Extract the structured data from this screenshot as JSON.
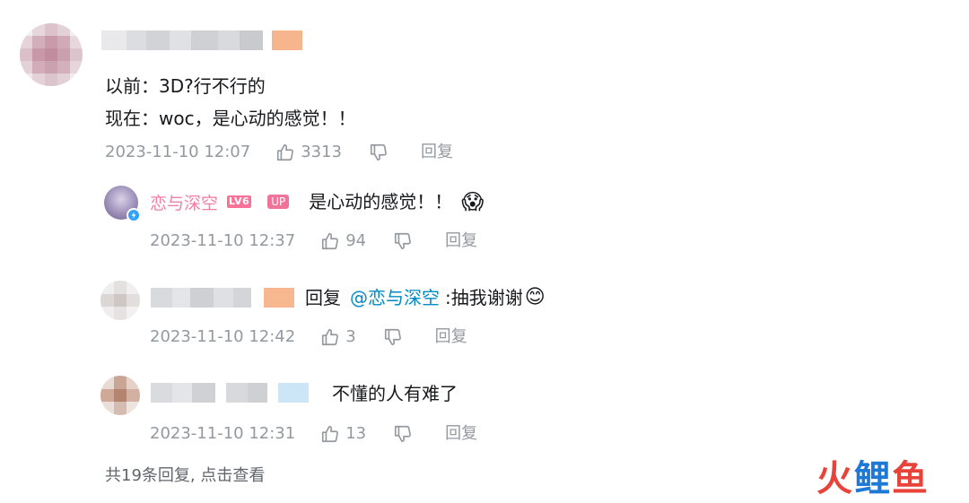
{
  "comment": {
    "line1": "以前：3D?行不行的",
    "line2": "现在：woc，是心动的感觉！！",
    "time": "2023-11-10 12:07",
    "likes": "3313",
    "reply_label": "回复"
  },
  "replies": [
    {
      "user": "恋与深空",
      "level_badge": "LV6",
      "up_badge": "UP",
      "text": "是心动的感觉！！",
      "emoji": "😱",
      "time": "2023-11-10 12:37",
      "likes": "94",
      "reply_label": "回复"
    },
    {
      "prefix": "回复",
      "mention": "@恋与深空",
      "text": ":抽我谢谢",
      "emoji": "😊",
      "time": "2023-11-10 12:42",
      "likes": "3",
      "reply_label": "回复"
    },
    {
      "text": "不懂的人有难了",
      "time": "2023-11-10 12:31",
      "likes": "13",
      "reply_label": "回复"
    }
  ],
  "more_replies": "共19条回复, 点击查看",
  "watermark": "火鲤鱼",
  "colors": {
    "meta": "#9499a0",
    "pink": "#f17fa6",
    "mention": "#008ac5",
    "watermark_red": "#e8433a",
    "watermark_blue": "#1e78d6"
  }
}
